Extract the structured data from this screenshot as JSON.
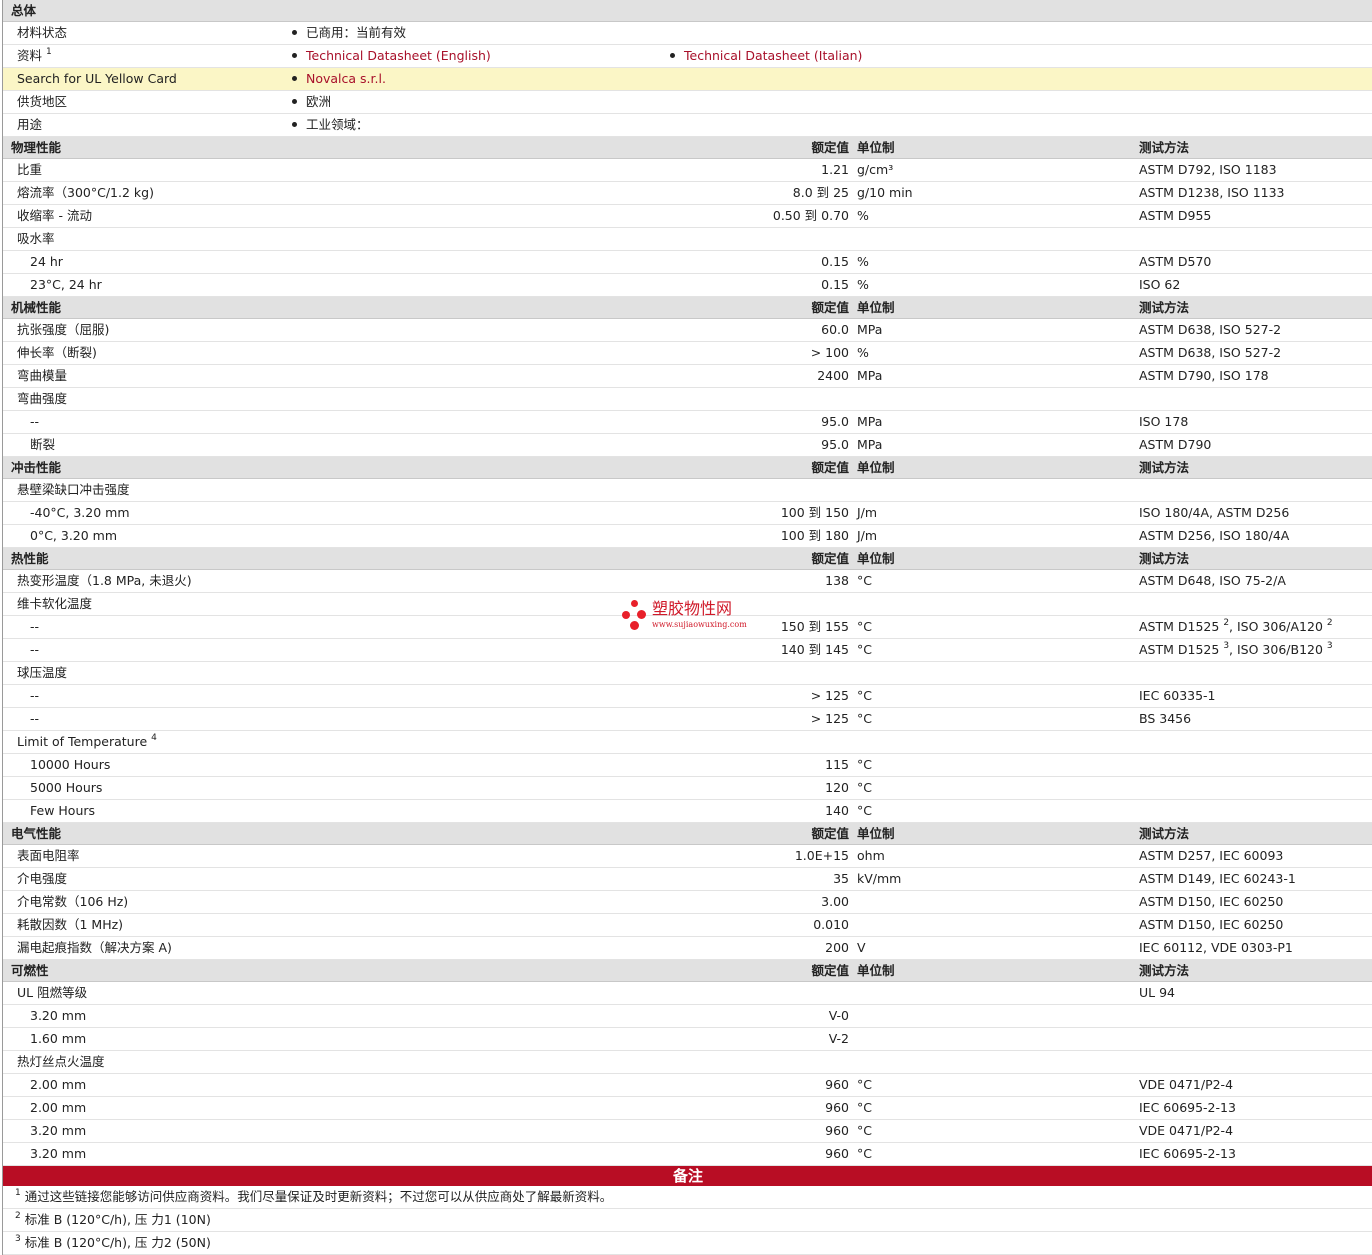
{
  "general": {
    "header": "总体",
    "rows": [
      {
        "label": "材料状态",
        "items": [
          "已商用：当前有效"
        ]
      },
      {
        "label": "资料",
        "sup": "1",
        "links": [
          "Technical Datasheet (English)",
          "Technical Datasheet (Italian)"
        ]
      },
      {
        "label": "Search for UL Yellow Card",
        "links": [
          "Novalca s.r.l."
        ]
      },
      {
        "label": "供货地区",
        "items": [
          "欧洲"
        ]
      },
      {
        "label": "用途",
        "items": [
          "工业领域："
        ]
      }
    ]
  },
  "sections": [
    {
      "header": "物理性能",
      "nominal": "额定值",
      "unit": "单位制",
      "method": "测试方法",
      "rows": [
        {
          "label": "比重",
          "value": "1.21",
          "unit": "g/cm³",
          "method": "ASTM D792, ISO 1183"
        },
        {
          "label": "熔流率（300°C/1.2 kg)",
          "value": "8.0 到  25",
          "unit": "g/10 min",
          "method": "ASTM D1238, ISO 1133"
        },
        {
          "label": "收缩率 - 流动",
          "value": "0.50 到  0.70",
          "unit": "%",
          "method": "ASTM D955"
        },
        {
          "label": "吸水率",
          "value": "",
          "unit": "",
          "method": ""
        },
        {
          "label": "24 hr",
          "sub": true,
          "value": "0.15",
          "unit": "%",
          "method": "ASTM D570"
        },
        {
          "label": "23°C, 24 hr",
          "sub": true,
          "value": "0.15",
          "unit": "%",
          "method": "ISO 62"
        }
      ]
    },
    {
      "header": "机械性能",
      "nominal": "额定值",
      "unit": "单位制",
      "method": "测试方法",
      "rows": [
        {
          "label": "抗张强度（屈服)",
          "value": "60.0",
          "unit": "MPa",
          "method": "ASTM D638, ISO 527-2"
        },
        {
          "label": "伸长率（断裂)",
          "value": "> 100",
          "unit": "%",
          "method": "ASTM D638, ISO 527-2"
        },
        {
          "label": "弯曲模量",
          "value": "2400",
          "unit": "MPa",
          "method": "ASTM D790, ISO 178"
        },
        {
          "label": "弯曲强度",
          "value": "",
          "unit": "",
          "method": ""
        },
        {
          "label": "--",
          "sub": true,
          "value": "95.0",
          "unit": "MPa",
          "method": "ISO 178"
        },
        {
          "label": "断裂",
          "sub": true,
          "value": "95.0",
          "unit": "MPa",
          "method": "ASTM D790"
        }
      ]
    },
    {
      "header": "冲击性能",
      "nominal": "额定值",
      "unit": "单位制",
      "method": "测试方法",
      "rows": [
        {
          "label": "悬壁梁缺口冲击强度",
          "value": "",
          "unit": "",
          "method": ""
        },
        {
          "label": "-40°C, 3.20 mm",
          "sub": true,
          "value": "100 到  150",
          "unit": "J/m",
          "method": "ISO 180/4A, ASTM D256"
        },
        {
          "label": "0°C, 3.20 mm",
          "sub": true,
          "value": "100 到  180",
          "unit": "J/m",
          "method": "ASTM D256, ISO 180/4A"
        }
      ]
    },
    {
      "header": "热性能",
      "nominal": "额定值",
      "unit": "单位制",
      "method": "测试方法",
      "rows": [
        {
          "label": "热变形温度（1.8 MPa, 未退火)",
          "value": "138",
          "unit": "°C",
          "method": "ASTM D648, ISO 75-2/A"
        },
        {
          "label": "维卡软化温度",
          "value": "",
          "unit": "",
          "method": ""
        },
        {
          "label": "--",
          "sub": true,
          "value": "150 到  155",
          "unit": "°C",
          "method": "ASTM D1525",
          "msup": "2",
          "method2": ", ISO 306/A120",
          "msup2": "2"
        },
        {
          "label": "--",
          "sub": true,
          "value": "140 到  145",
          "unit": "°C",
          "method": "ASTM D1525",
          "msup": "3",
          "method2": ", ISO 306/B120",
          "msup2": "3"
        },
        {
          "label": "球压温度",
          "value": "",
          "unit": "",
          "method": ""
        },
        {
          "label": "--",
          "sub": true,
          "value": "> 125",
          "unit": "°C",
          "method": "IEC 60335-1"
        },
        {
          "label": "--",
          "sub": true,
          "value": "> 125",
          "unit": "°C",
          "method": "BS 3456"
        },
        {
          "label": "Limit of Temperature",
          "sup": "4",
          "value": "",
          "unit": "",
          "method": ""
        },
        {
          "label": "10000 Hours",
          "sub": true,
          "value": "115",
          "unit": "°C",
          "method": ""
        },
        {
          "label": "5000 Hours",
          "sub": true,
          "value": "120",
          "unit": "°C",
          "method": ""
        },
        {
          "label": "Few Hours",
          "sub": true,
          "value": "140",
          "unit": "°C",
          "method": ""
        }
      ]
    },
    {
      "header": "电气性能",
      "nominal": "额定值",
      "unit": "单位制",
      "method": "测试方法",
      "rows": [
        {
          "label": "表面电阻率",
          "value": "1.0E+15",
          "unit": "ohm",
          "method": "ASTM D257, IEC 60093"
        },
        {
          "label": "介电强度",
          "value": "35",
          "unit": "kV/mm",
          "method": "ASTM D149, IEC 60243-1"
        },
        {
          "label": "介电常数（106 Hz)",
          "value": "3.00",
          "unit": "",
          "method": "ASTM D150, IEC 60250"
        },
        {
          "label": "耗散因数（1 MHz)",
          "value": "0.010",
          "unit": "",
          "method": "ASTM D150, IEC 60250"
        },
        {
          "label": "漏电起痕指数（解决方案 A)",
          "value": "200",
          "unit": "V",
          "method": "IEC 60112, VDE 0303-P1"
        }
      ]
    },
    {
      "header": "可燃性",
      "nominal": "额定值",
      "unit": "单位制",
      "method": "测试方法",
      "rows": [
        {
          "label": "UL 阻燃等级",
          "value": "",
          "unit": "",
          "method": "UL 94"
        },
        {
          "label": "3.20 mm",
          "sub": true,
          "value": "V-0",
          "unit": "",
          "method": ""
        },
        {
          "label": "1.60 mm",
          "sub": true,
          "value": "V-2",
          "unit": "",
          "method": ""
        },
        {
          "label": "热灯丝点火温度",
          "value": "",
          "unit": "",
          "method": ""
        },
        {
          "label": "2.00 mm",
          "sub": true,
          "value": "960",
          "unit": "°C",
          "method": "VDE 0471/P2-4"
        },
        {
          "label": "2.00 mm",
          "sub": true,
          "value": "960",
          "unit": "°C",
          "method": "IEC 60695-2-13"
        },
        {
          "label": "3.20 mm",
          "sub": true,
          "value": "960",
          "unit": "°C",
          "method": "VDE 0471/P2-4"
        },
        {
          "label": "3.20 mm",
          "sub": true,
          "value": "960",
          "unit": "°C",
          "method": "IEC 60695-2-13"
        }
      ]
    }
  ],
  "notes": {
    "header": "备注",
    "items": [
      {
        "num": "1",
        "text": "通过这些链接您能够访问供应商资料。我们尽量保证及时更新资料；不过您可以从供应商处了解最新资料。"
      },
      {
        "num": "2",
        "text": "标准 B (120°C/h), 压  力1 (10N)"
      },
      {
        "num": "3",
        "text": "标准 B (120°C/h), 压  力2 (50N)"
      }
    ]
  },
  "watermark": {
    "title": "塑胶物性网",
    "url": "www.sujiaowuxing.com"
  },
  "colors": {
    "link": "#a8102a",
    "notes_bar": "#b80d24",
    "highlight": "#fbf6c6",
    "header_bg": "#e1e1e1"
  }
}
